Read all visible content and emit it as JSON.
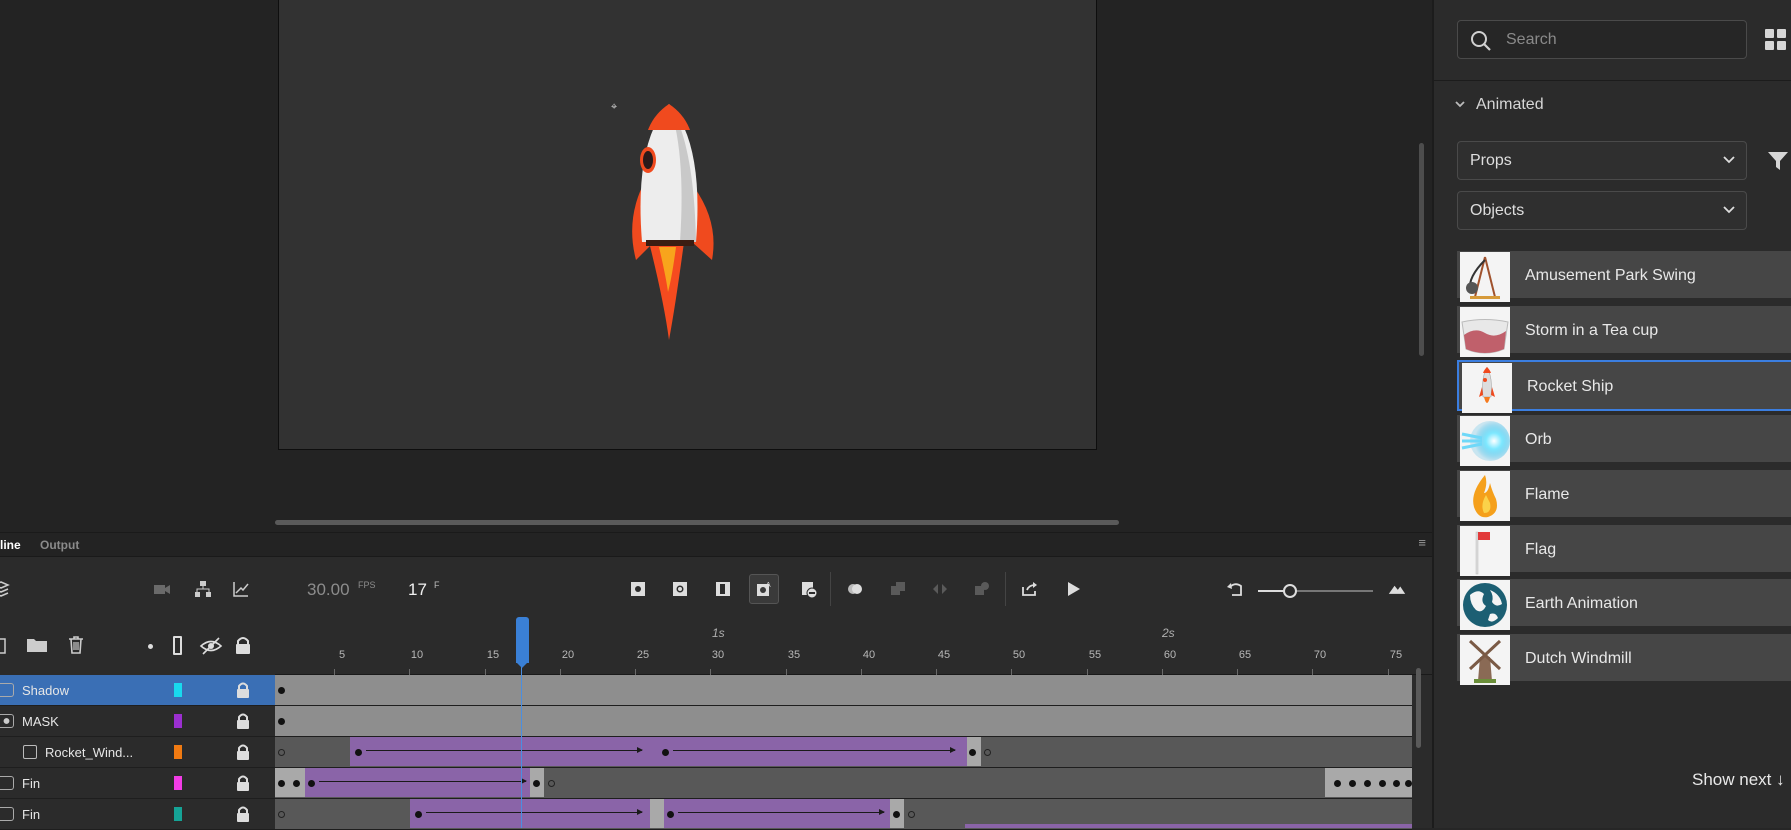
{
  "timeline": {
    "tabs": [
      "line",
      "Output"
    ],
    "fps": "30.00",
    "fps_unit": "FPS",
    "frame": "17",
    "frame_unit": "F",
    "second_labels": [
      "1s",
      "2s"
    ],
    "ticks": [
      "5",
      "10",
      "15",
      "20",
      "25",
      "30",
      "35",
      "40",
      "45",
      "50",
      "55",
      "60",
      "65",
      "70",
      "75"
    ],
    "layers": [
      {
        "name": "Shadow",
        "color": "#19d9ee",
        "selected": true
      },
      {
        "name": "MASK",
        "color": "#9b2fd0",
        "selected": false
      },
      {
        "name": "Rocket_Wind...",
        "color": "#f07a12",
        "selected": false
      },
      {
        "name": "Fin",
        "color": "#f23ce6",
        "selected": false
      },
      {
        "name": "Fin",
        "color": "#15a396",
        "selected": false
      }
    ],
    "playhead_frame": 17
  },
  "assets": {
    "search_placeholder": "Search",
    "section_title": "Animated",
    "category_select": "Props",
    "subcategory_select": "Objects",
    "items": [
      {
        "label": "Amusement Park Swing",
        "icon": "swing-thumb"
      },
      {
        "label": "Storm in a Tea cup",
        "icon": "teacup-thumb"
      },
      {
        "label": "Rocket Ship",
        "icon": "rocket-thumb",
        "selected": true
      },
      {
        "label": "Orb",
        "icon": "orb-thumb"
      },
      {
        "label": "Flame",
        "icon": "flame-thumb"
      },
      {
        "label": "Flag",
        "icon": "flag-thumb"
      },
      {
        "label": "Earth Animation",
        "icon": "earth-thumb"
      },
      {
        "label": "Dutch Windmill",
        "icon": "windmill-thumb"
      }
    ],
    "show_next": "Show next ↓"
  },
  "colors": {
    "accent": "#3b7ee0",
    "tween": "#8a64a8",
    "rocket_red": "#f04a1e"
  }
}
